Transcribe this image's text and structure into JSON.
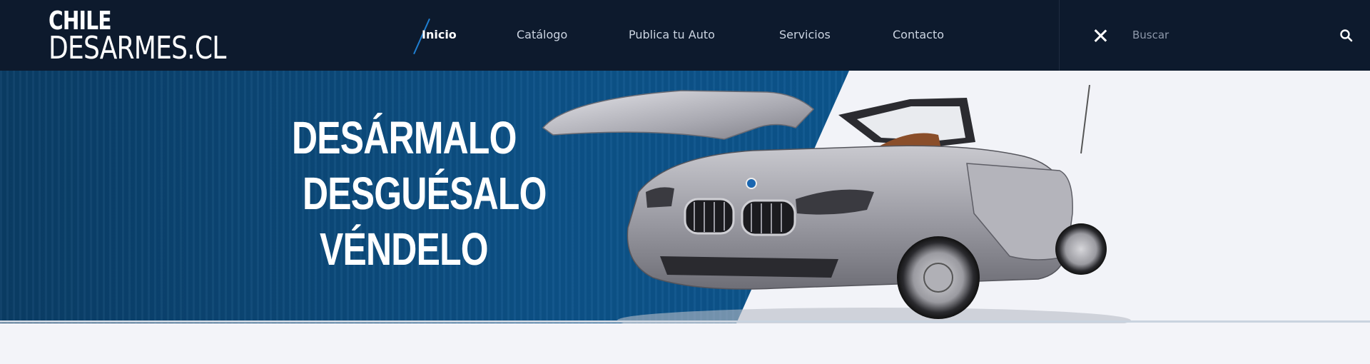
{
  "logo": {
    "line1": "CHILE",
    "line2": "DESARMES.CL"
  },
  "nav": {
    "items": [
      {
        "label": "Inicio",
        "active": true
      },
      {
        "label": "Catálogo",
        "active": false
      },
      {
        "label": "Publica tu Auto",
        "active": false
      },
      {
        "label": "Servicios",
        "active": false
      },
      {
        "label": "Contacto",
        "active": false
      }
    ]
  },
  "search": {
    "placeholder": "Buscar",
    "value": ""
  },
  "hero": {
    "slogan": [
      "DESÁRMALO",
      "DESGUÉSALO",
      "VÉNDELO"
    ]
  },
  "colors": {
    "navbar_bg": "#0d1a2d",
    "accent": "#1f7ed0",
    "hero_blue": "#0b568f",
    "page_bg": "#f3f4f9"
  },
  "icons": {
    "close": "close-icon",
    "search": "search-icon"
  }
}
